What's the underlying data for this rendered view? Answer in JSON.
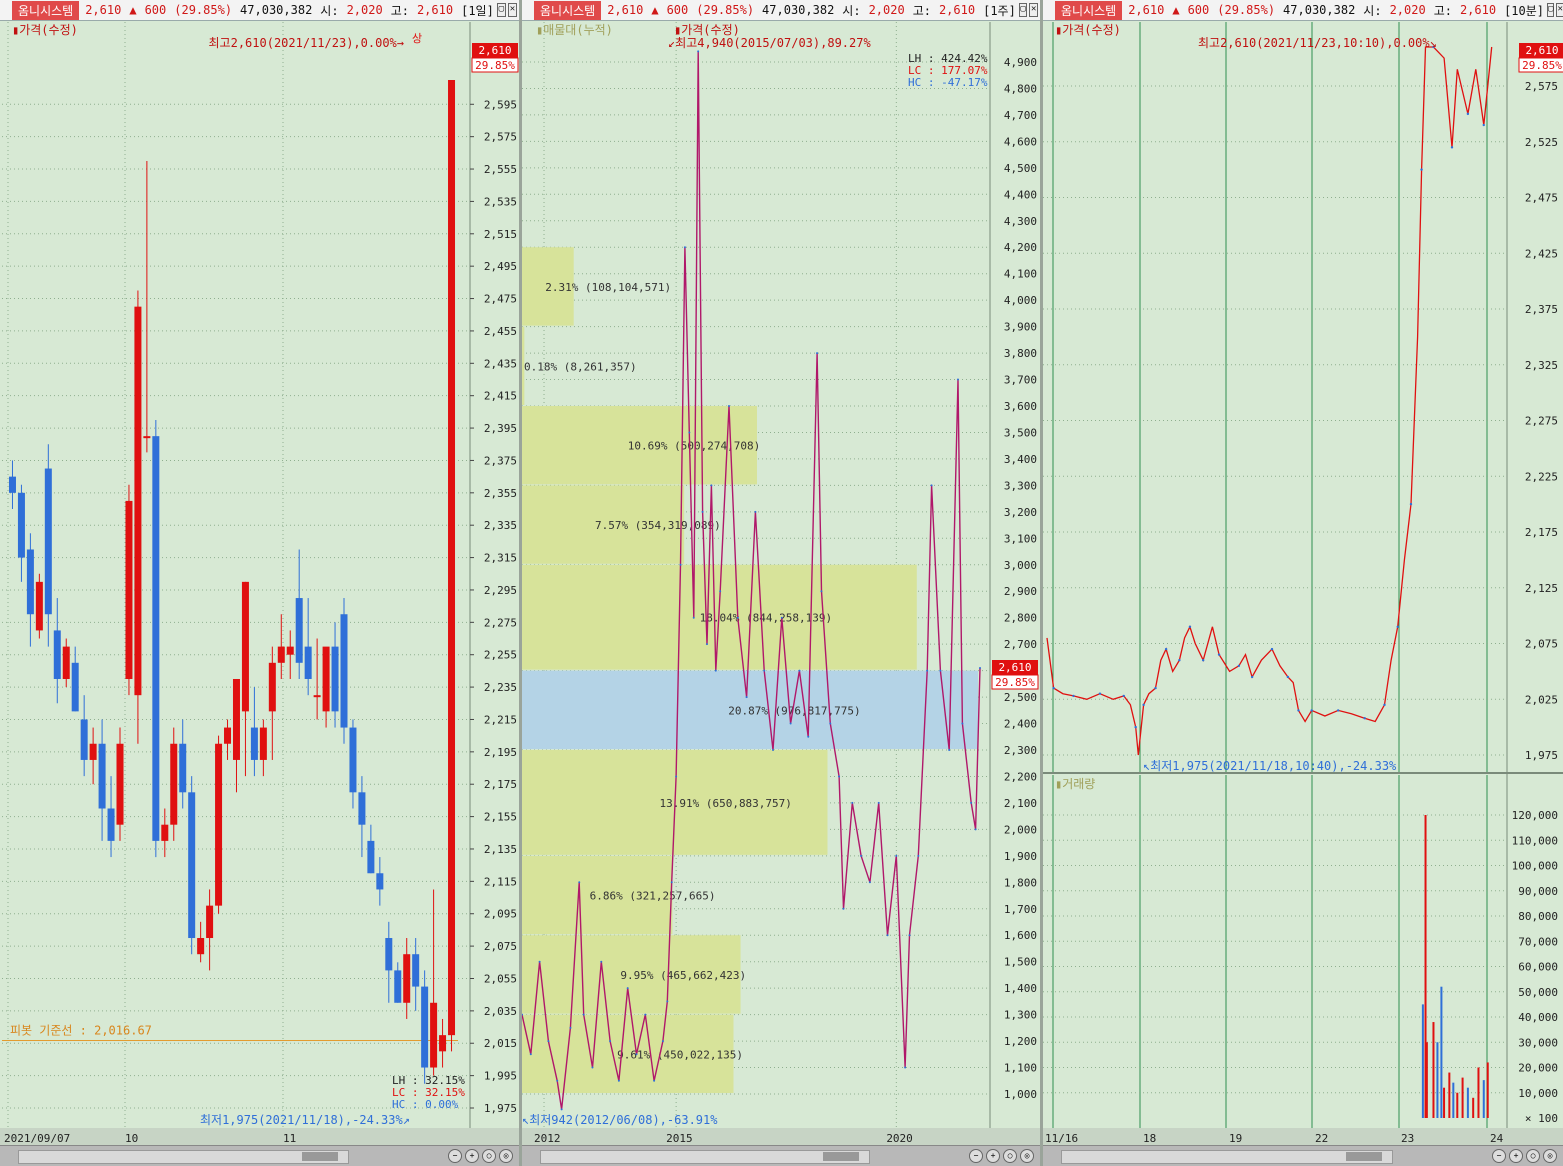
{
  "header": {
    "stock_name": "옴니시스템",
    "price": "2,610",
    "change": "600",
    "change_pct": "(29.85%)",
    "volume": "47,030,382",
    "open_label": "시:",
    "open": "2,020",
    "high_label": "고:",
    "high": "2,610"
  },
  "panels": [
    {
      "period": "[1일]"
    },
    {
      "period": "[1주]"
    },
    {
      "period": "[10분]"
    }
  ],
  "colors": {
    "up": "#e01010",
    "down": "#2f6fd8",
    "bg": "#d7e9d4",
    "profile": "#d7e39a",
    "profile_hl": "#b4d3e6"
  },
  "chart_data": [
    {
      "type": "candlestick",
      "timeframe": "daily",
      "series_label": "가격(수정)",
      "ylim": [
        1975,
        2610
      ],
      "y_ticks": [
        1975,
        1995,
        2015,
        2035,
        2055,
        2075,
        2095,
        2115,
        2135,
        2155,
        2175,
        2195,
        2215,
        2235,
        2255,
        2275,
        2295,
        2315,
        2335,
        2355,
        2375,
        2395,
        2415,
        2435,
        2455,
        2475,
        2495,
        2515,
        2535,
        2555,
        2575,
        2595
      ],
      "x_ticks": [
        "2021/09/07",
        "10",
        "11"
      ],
      "high_note": "최고2,610(2021/11/23),0.00%",
      "low_note": "최저1,975(2021/11/18),-24.33%",
      "pivot_label": "피봇 기준선 : 2,016.67",
      "pivot": 2016.67,
      "last_price": "2,610",
      "last_pct": "29.85%",
      "limit_mark": "상",
      "stats": [
        {
          "k": "LH",
          "v": "32.15%"
        },
        {
          "k": "LC",
          "v": "32.15%"
        },
        {
          "k": "HC",
          "v": "0.00%"
        }
      ],
      "candles": [
        [
          2365,
          2375,
          2345,
          2355
        ],
        [
          2355,
          2360,
          2300,
          2315
        ],
        [
          2320,
          2330,
          2260,
          2280
        ],
        [
          2270,
          2305,
          2265,
          2300
        ],
        [
          2370,
          2385,
          2260,
          2280
        ],
        [
          2270,
          2290,
          2225,
          2240
        ],
        [
          2240,
          2265,
          2235,
          2260
        ],
        [
          2250,
          2260,
          2220,
          2220
        ],
        [
          2215,
          2230,
          2180,
          2190
        ],
        [
          2190,
          2210,
          2175,
          2200
        ],
        [
          2200,
          2215,
          2140,
          2160
        ],
        [
          2160,
          2180,
          2130,
          2140
        ],
        [
          2150,
          2210,
          2140,
          2200
        ],
        [
          2240,
          2360,
          2230,
          2350
        ],
        [
          2230,
          2480,
          2200,
          2470
        ],
        [
          2390,
          2560,
          2380,
          2390
        ],
        [
          2390,
          2400,
          2130,
          2140
        ],
        [
          2140,
          2160,
          2130,
          2150
        ],
        [
          2150,
          2210,
          2140,
          2200
        ],
        [
          2200,
          2215,
          2160,
          2170
        ],
        [
          2170,
          2180,
          2070,
          2080
        ],
        [
          2070,
          2090,
          2065,
          2080
        ],
        [
          2080,
          2110,
          2060,
          2100
        ],
        [
          2100,
          2205,
          2095,
          2200
        ],
        [
          2200,
          2215,
          2190,
          2210
        ],
        [
          2190,
          2240,
          2170,
          2240
        ],
        [
          2220,
          2300,
          2180,
          2300
        ],
        [
          2210,
          2235,
          2180,
          2190
        ],
        [
          2190,
          2215,
          2180,
          2210
        ],
        [
          2220,
          2260,
          2190,
          2250
        ],
        [
          2250,
          2280,
          2240,
          2260
        ],
        [
          2255,
          2270,
          2240,
          2260
        ],
        [
          2290,
          2320,
          2240,
          2250
        ],
        [
          2260,
          2290,
          2230,
          2240
        ],
        [
          2230,
          2265,
          2215,
          2230
        ],
        [
          2220,
          2250,
          2210,
          2260
        ],
        [
          2260,
          2275,
          2210,
          2220
        ],
        [
          2280,
          2290,
          2200,
          2210
        ],
        [
          2210,
          2215,
          2160,
          2170
        ],
        [
          2170,
          2180,
          2130,
          2150
        ],
        [
          2140,
          2150,
          2120,
          2120
        ],
        [
          2120,
          2130,
          2100,
          2110
        ],
        [
          2080,
          2090,
          2040,
          2060
        ],
        [
          2060,
          2065,
          2040,
          2040
        ],
        [
          2040,
          2080,
          2030,
          2070
        ],
        [
          2070,
          2080,
          2035,
          2050
        ],
        [
          2050,
          2060,
          1990,
          2000
        ],
        [
          2000,
          2110,
          1995,
          2040
        ],
        [
          2010,
          2030,
          2000,
          2020
        ],
        [
          2020,
          2610,
          2010,
          2610
        ]
      ]
    },
    {
      "type": "line",
      "timeframe": "weekly",
      "series_label": "가격(수정)",
      "profile_label": "매물대(누적)",
      "ylim": [
        900,
        5000
      ],
      "y_ticks": [
        1000,
        1100,
        1200,
        1300,
        1400,
        1500,
        1600,
        1700,
        1800,
        1900,
        2000,
        2100,
        2200,
        2300,
        2400,
        2500,
        2600,
        2700,
        2800,
        2900,
        3000,
        3100,
        3200,
        3300,
        3400,
        3500,
        3600,
        3700,
        3800,
        3900,
        4000,
        4100,
        4200,
        4300,
        4400,
        4500,
        4600,
        4700,
        4800,
        4900
      ],
      "x_ticks": [
        "2012",
        "2015",
        "2020"
      ],
      "high_note": "최고4,940(2015/07/03),89.27%",
      "low_note": "최저942(2012/06/08),-63.91%",
      "last_price": "2,610",
      "last_pct": "29.85%",
      "stats": [
        {
          "k": "LH",
          "v": "424.42%"
        },
        {
          "k": "LC",
          "v": "177.07%"
        },
        {
          "k": "HC",
          "v": "-47.17%"
        }
      ],
      "x_range": [
        2011.5,
        2021.9
      ],
      "points": [
        [
          2011.5,
          1300
        ],
        [
          2011.7,
          1150
        ],
        [
          2011.9,
          1500
        ],
        [
          2012.1,
          1200
        ],
        [
          2012.3,
          1050
        ],
        [
          2012.4,
          942
        ],
        [
          2012.6,
          1250
        ],
        [
          2012.8,
          1800
        ],
        [
          2012.9,
          1300
        ],
        [
          2013.1,
          1100
        ],
        [
          2013.3,
          1500
        ],
        [
          2013.5,
          1200
        ],
        [
          2013.7,
          1050
        ],
        [
          2013.9,
          1400
        ],
        [
          2014.1,
          1150
        ],
        [
          2014.3,
          1300
        ],
        [
          2014.5,
          1050
        ],
        [
          2014.7,
          1200
        ],
        [
          2014.8,
          1350
        ],
        [
          2014.9,
          1800
        ],
        [
          2015.0,
          2200
        ],
        [
          2015.1,
          3000
        ],
        [
          2015.2,
          4200
        ],
        [
          2015.3,
          3500
        ],
        [
          2015.4,
          2800
        ],
        [
          2015.5,
          4940
        ],
        [
          2015.6,
          3200
        ],
        [
          2015.7,
          2700
        ],
        [
          2015.8,
          3300
        ],
        [
          2015.9,
          2600
        ],
        [
          2016.0,
          2900
        ],
        [
          2016.2,
          3600
        ],
        [
          2016.4,
          2800
        ],
        [
          2016.6,
          2500
        ],
        [
          2016.8,
          3200
        ],
        [
          2017.0,
          2600
        ],
        [
          2017.2,
          2300
        ],
        [
          2017.4,
          2800
        ],
        [
          2017.6,
          2400
        ],
        [
          2017.8,
          2600
        ],
        [
          2018.0,
          2350
        ],
        [
          2018.2,
          3800
        ],
        [
          2018.3,
          2900
        ],
        [
          2018.5,
          2400
        ],
        [
          2018.7,
          2200
        ],
        [
          2018.8,
          1700
        ],
        [
          2019.0,
          2100
        ],
        [
          2019.2,
          1900
        ],
        [
          2019.4,
          1800
        ],
        [
          2019.6,
          2100
        ],
        [
          2019.8,
          1600
        ],
        [
          2020.0,
          1900
        ],
        [
          2020.2,
          1100
        ],
        [
          2020.3,
          1600
        ],
        [
          2020.5,
          1900
        ],
        [
          2020.7,
          2600
        ],
        [
          2020.8,
          3300
        ],
        [
          2021.0,
          2600
        ],
        [
          2021.2,
          2300
        ],
        [
          2021.4,
          3700
        ],
        [
          2021.5,
          2400
        ],
        [
          2021.7,
          2100
        ],
        [
          2021.8,
          2000
        ],
        [
          2021.9,
          2610
        ]
      ],
      "profile": [
        {
          "low": 3900,
          "high": 4200,
          "pct_label": "2.31% (108,104,571)",
          "frac": 0.22
        },
        {
          "low": 3600,
          "high": 3900,
          "pct_label": "0.18% (8,261,357)",
          "frac": 0.01
        },
        {
          "low": 3300,
          "high": 3600,
          "pct_label": "10.69% (500,274,708)",
          "frac": 1.0
        },
        {
          "low": 3000,
          "high": 3300,
          "pct_label": "7.57% (354,319,089)",
          "frac": 0.69
        },
        {
          "low": 2600,
          "high": 3000,
          "pct_label": "18.04% (844,258,139)",
          "frac": 1.68
        },
        {
          "low": 2300,
          "high": 2600,
          "pct_label": "20.87% (976,817,775)",
          "frac": 1.95
        },
        {
          "low": 1900,
          "high": 2300,
          "pct_label": "13.91% (650,883,757)",
          "frac": 1.3
        },
        {
          "low": 1600,
          "high": 1900,
          "pct_label": "6.86% (321,257,665)",
          "frac": 0.64
        },
        {
          "low": 1300,
          "high": 1600,
          "pct_label": "9.95% (465,662,423)",
          "frac": 0.93
        },
        {
          "low": 1000,
          "high": 1300,
          "pct_label": "9.61% (450,022,135)",
          "frac": 0.9
        }
      ]
    },
    {
      "type": "line",
      "timeframe": "10min",
      "series_label": "가격(수정)",
      "ylim": [
        1960,
        2625
      ],
      "y_ticks": [
        1975,
        2025,
        2075,
        2125,
        2175,
        2225,
        2275,
        2325,
        2375,
        2425,
        2475,
        2525,
        2575
      ],
      "x_ticks": [
        "11/16",
        "18",
        "19",
        "22",
        "23",
        "24"
      ],
      "high_note": "최고2,610(2021/11/23,10:10),0.00%",
      "low_note": "최저1,975(2021/11/18,10:40),-24.33%",
      "last_price": "2,610",
      "last_pct": "29.85%",
      "points": [
        [
          0,
          2080
        ],
        [
          5,
          2035
        ],
        [
          12,
          2030
        ],
        [
          20,
          2028
        ],
        [
          30,
          2025
        ],
        [
          40,
          2030
        ],
        [
          50,
          2025
        ],
        [
          58,
          2028
        ],
        [
          63,
          2020
        ],
        [
          67,
          2000
        ],
        [
          69,
          1975
        ],
        [
          73,
          2020
        ],
        [
          77,
          2030
        ],
        [
          82,
          2035
        ],
        [
          86,
          2060
        ],
        [
          90,
          2070
        ],
        [
          95,
          2050
        ],
        [
          100,
          2060
        ],
        [
          104,
          2080
        ],
        [
          108,
          2090
        ],
        [
          112,
          2075
        ],
        [
          118,
          2060
        ],
        [
          125,
          2090
        ],
        [
          130,
          2065
        ],
        [
          138,
          2050
        ],
        [
          145,
          2055
        ],
        [
          150,
          2065
        ],
        [
          155,
          2045
        ],
        [
          162,
          2060
        ],
        [
          170,
          2070
        ],
        [
          176,
          2055
        ],
        [
          182,
          2045
        ],
        [
          186,
          2040
        ],
        [
          190,
          2015
        ],
        [
          195,
          2005
        ],
        [
          200,
          2015
        ],
        [
          210,
          2010
        ],
        [
          220,
          2015
        ],
        [
          230,
          2012
        ],
        [
          240,
          2008
        ],
        [
          248,
          2005
        ],
        [
          255,
          2020
        ],
        [
          260,
          2060
        ],
        [
          265,
          2090
        ],
        [
          270,
          2150
        ],
        [
          275,
          2200
        ],
        [
          280,
          2350
        ],
        [
          283,
          2500
        ],
        [
          286,
          2610
        ],
        [
          292,
          2610
        ],
        [
          300,
          2600
        ],
        [
          306,
          2520
        ],
        [
          310,
          2590
        ],
        [
          318,
          2550
        ],
        [
          324,
          2590
        ],
        [
          330,
          2540
        ],
        [
          336,
          2610
        ]
      ]
    },
    {
      "type": "bar",
      "timeframe": "10min",
      "series_label": "거래량",
      "unit": "× 100",
      "ylim": [
        0,
        130000
      ],
      "y_ticks": [
        10000,
        20000,
        30000,
        40000,
        50000,
        60000,
        70000,
        80000,
        90000,
        100000,
        110000,
        120000
      ],
      "x_ticks": [
        "11/16",
        "18",
        "19",
        "22",
        "23",
        "24"
      ],
      "spikes": [
        {
          "x": 284,
          "v": 45000,
          "up": false
        },
        {
          "x": 286,
          "v": 120000,
          "up": true
        },
        {
          "x": 287,
          "v": 30000,
          "up": true
        },
        {
          "x": 292,
          "v": 38000,
          "up": true
        },
        {
          "x": 295,
          "v": 30000,
          "up": false
        },
        {
          "x": 298,
          "v": 52000,
          "up": false
        },
        {
          "x": 300,
          "v": 12000,
          "up": true
        },
        {
          "x": 304,
          "v": 18000,
          "up": true
        },
        {
          "x": 307,
          "v": 14000,
          "up": false
        },
        {
          "x": 310,
          "v": 10000,
          "up": true
        },
        {
          "x": 314,
          "v": 16000,
          "up": true
        },
        {
          "x": 318,
          "v": 12000,
          "up": false
        },
        {
          "x": 322,
          "v": 8000,
          "up": true
        },
        {
          "x": 326,
          "v": 20000,
          "up": true
        },
        {
          "x": 330,
          "v": 15000,
          "up": false
        },
        {
          "x": 333,
          "v": 22000,
          "up": true
        }
      ]
    }
  ]
}
